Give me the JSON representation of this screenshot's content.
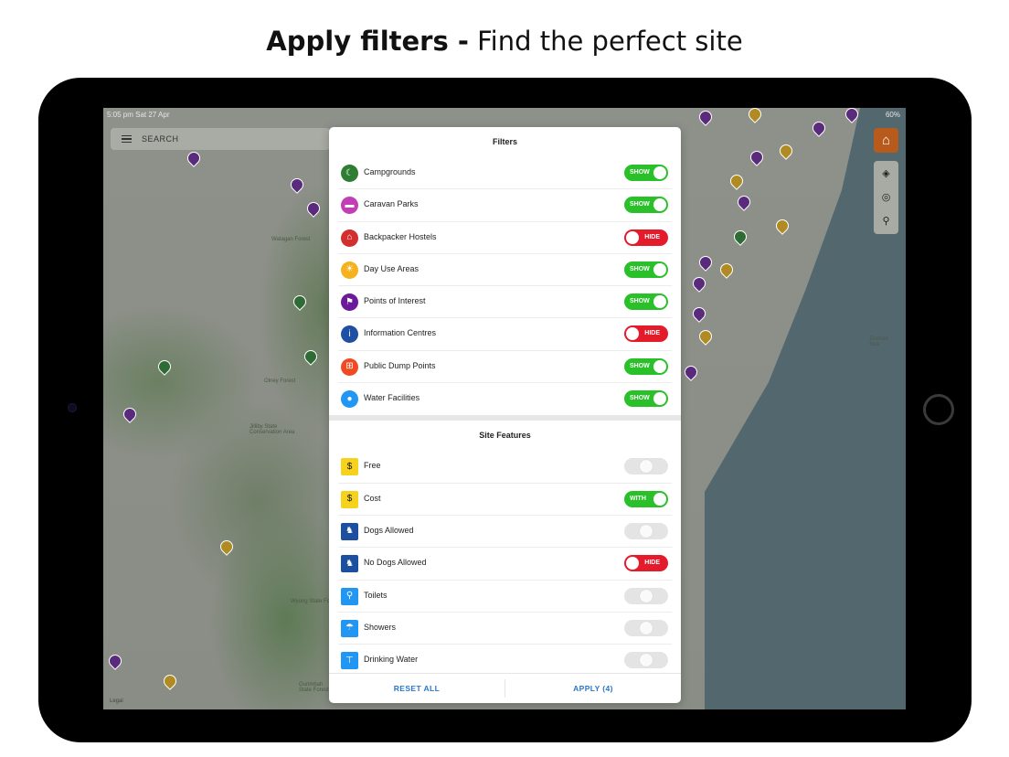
{
  "headline": {
    "bold": "Apply filters -",
    "rest": "Find the perfect site"
  },
  "status": {
    "time": "5:05 pm  Sat 27 Apr",
    "battery": "60%"
  },
  "search": {
    "label": "SEARCH"
  },
  "map_labels": [
    "Watagan Forest",
    "Olney Forest",
    "Jilliby State Conservation Area",
    "Wyong State Forest",
    "Ourimbah State Forest",
    "Tasman Sea"
  ],
  "legal": "Legal",
  "icons": {
    "home": "home-icon",
    "layers": "layers-icon",
    "locate": "locate-icon",
    "pin": "pin-icon"
  },
  "filters": {
    "title": "Filters",
    "items": [
      {
        "label": "Campgrounds",
        "state": "SHOW",
        "icon": "tent-icon",
        "color": "#2e7d32"
      },
      {
        "label": "Caravan Parks",
        "state": "SHOW",
        "icon": "caravan-icon",
        "color": "#c23eb5"
      },
      {
        "label": "Backpacker Hostels",
        "state": "HIDE",
        "icon": "hostel-icon",
        "color": "#d32f2f"
      },
      {
        "label": "Day Use Areas",
        "state": "SHOW",
        "icon": "sun-icon",
        "color": "#f6b21e"
      },
      {
        "label": "Points of Interest",
        "state": "SHOW",
        "icon": "flag-icon",
        "color": "#6a1b9a"
      },
      {
        "label": "Information Centres",
        "state": "HIDE",
        "icon": "info-icon",
        "color": "#1e4fa3"
      },
      {
        "label": "Public Dump Points",
        "state": "SHOW",
        "icon": "dump-icon",
        "color": "#ef4a24"
      },
      {
        "label": "Water Facilities",
        "state": "SHOW",
        "icon": "water-drop-icon",
        "color": "#2196f3"
      }
    ]
  },
  "features": {
    "title": "Site Features",
    "items": [
      {
        "label": "Free",
        "state": "",
        "icon": "no-dollar-icon",
        "color": "#f7d21c"
      },
      {
        "label": "Cost",
        "state": "WITH",
        "icon": "dollar-icon",
        "color": "#f7d21c"
      },
      {
        "label": "Dogs Allowed",
        "state": "",
        "icon": "dog-icon",
        "color": "#1d4fa0"
      },
      {
        "label": "No Dogs Allowed",
        "state": "HIDE",
        "icon": "no-dog-icon",
        "color": "#1d4fa0"
      },
      {
        "label": "Toilets",
        "state": "",
        "icon": "toilet-icon",
        "color": "#2196f3"
      },
      {
        "label": "Showers",
        "state": "",
        "icon": "shower-icon",
        "color": "#2196f3"
      },
      {
        "label": "Drinking Water",
        "state": "",
        "icon": "tap-icon",
        "color": "#2196f3"
      }
    ]
  },
  "footer": {
    "reset": "RESET ALL",
    "apply": "APPLY (4)"
  },
  "colors": {
    "show": "#2ac02a",
    "hide": "#e31b2b",
    "off": "#e4e4e4",
    "accent": "#2b76c8",
    "home_button": "#b75a1c"
  }
}
